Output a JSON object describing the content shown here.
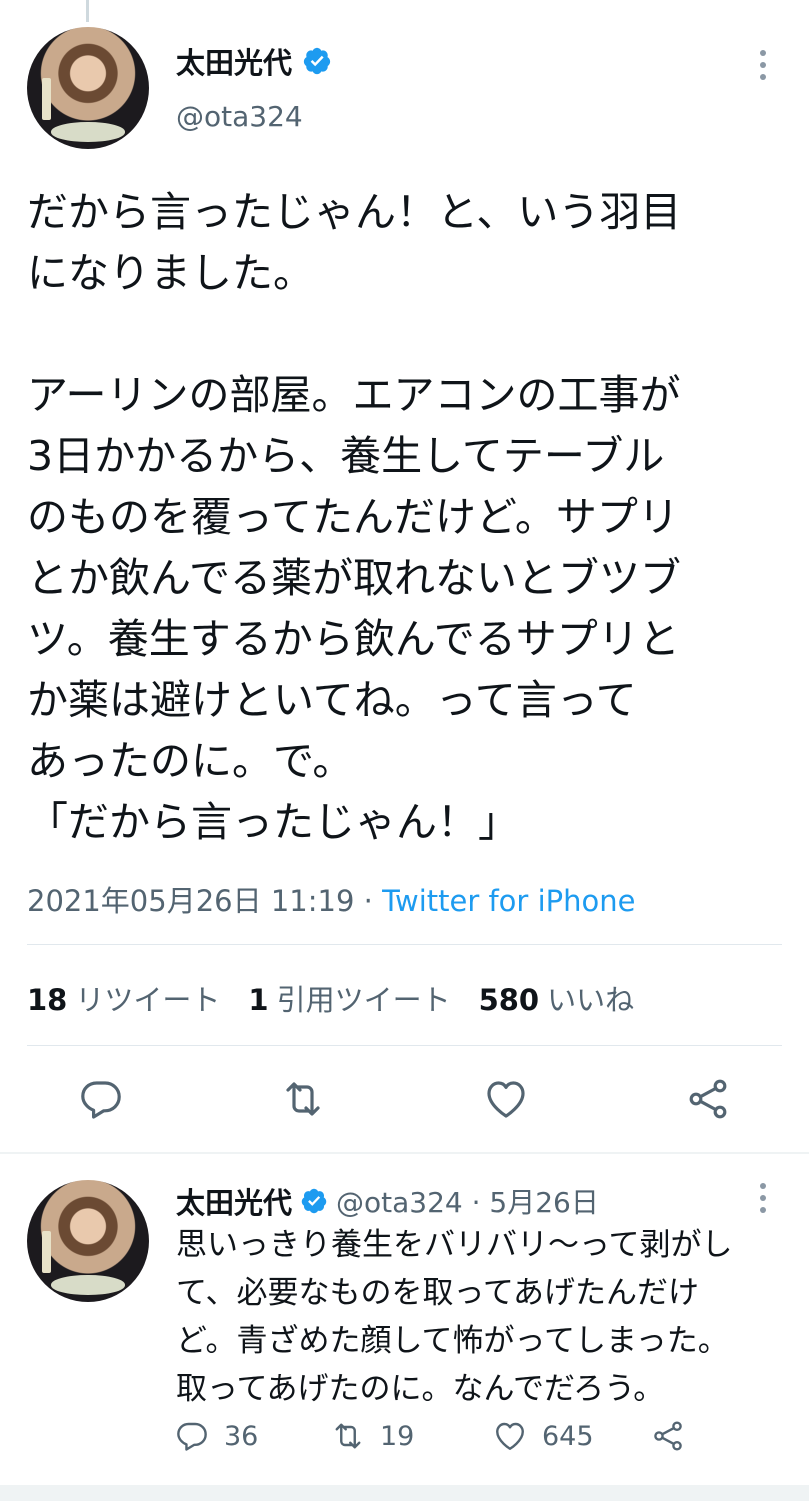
{
  "main_tweet": {
    "display_name": "太田光代",
    "handle": "@ota324",
    "text": "だから言ったじゃん！と、いう羽目\nになりました。\n\nアーリンの部屋。エアコンの工事が\n3日かかるから、養生してテーブル\nのものを覆ってたんだけど。サプリ\nとか飲んでる薬が取れないとブツブ\nツ。養生するから飲んでるサプリと\nか薬は避けといてね。って言って\nあったのに。で。\n「だから言ったじゃん！」",
    "timestamp": "2021年05月26日 11:19 · ",
    "source": "Twitter for iPhone",
    "stats": {
      "retweets_count": "18",
      "retweets_label": "リツイート",
      "quotes_count": "1",
      "quotes_label": "引用ツイート",
      "likes_count": "580",
      "likes_label": "いいね"
    }
  },
  "reply_tweet": {
    "display_name": "太田光代",
    "handle_date": "@ota324 · 5月26日",
    "text": "思いっきり養生をバリバリ〜って剥がし\nて、必要なものを取ってあげたんだけ\nど。青ざめた顔して怖がってしまった。\n取ってあげたのに。なんでだろう。",
    "reply_count": "36",
    "retweet_count": "19",
    "like_count": "645"
  },
  "icons": {
    "verified": "verified-badge-icon",
    "more": "more-vertical-icon",
    "reply": "reply-icon",
    "retweet": "retweet-icon",
    "like": "heart-icon",
    "share": "share-icon"
  },
  "colors": {
    "accent": "#1d9bf0",
    "secondary_text": "#536471",
    "icon_gray": "#536471"
  }
}
